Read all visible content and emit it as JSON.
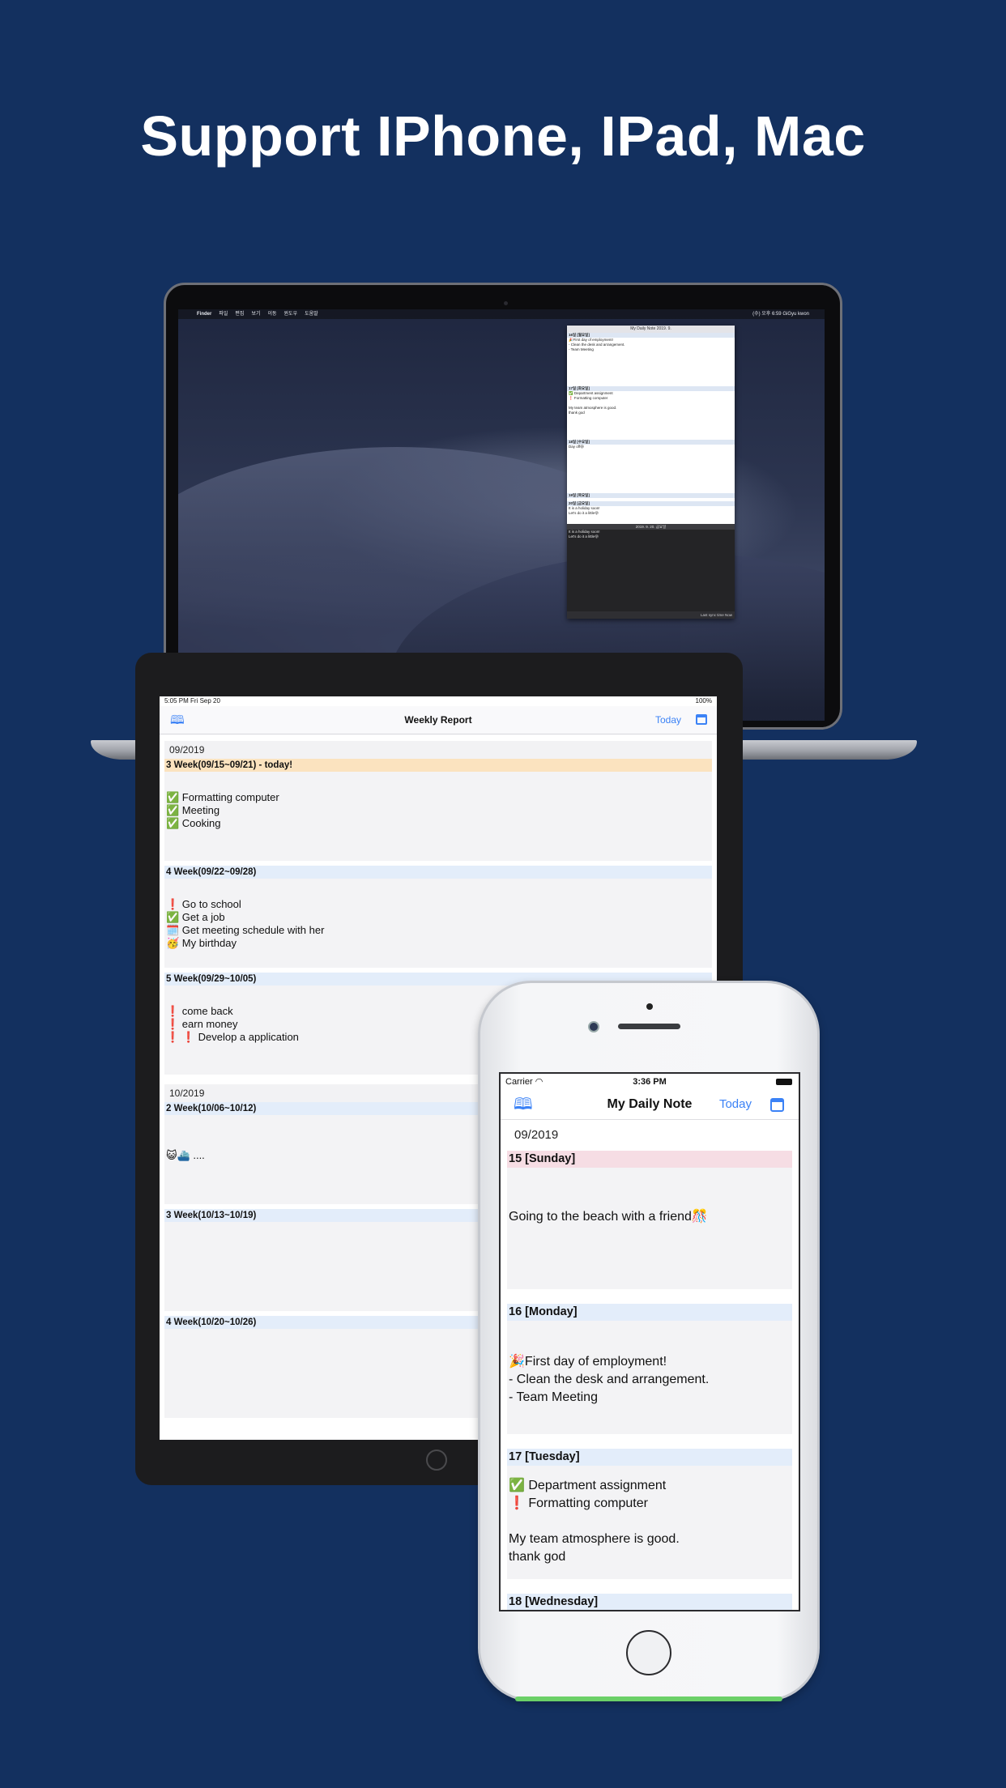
{
  "headline": "Support IPhone, IPad, Mac",
  "colors": {
    "background": "#13305f",
    "accent": "#3b82f6",
    "today_week": "#fbe3bf",
    "week_header": "#e3edfa",
    "sunday_header": "#f6dde4"
  },
  "mac": {
    "menubar_items": [
      "Finder",
      "파일",
      "편집",
      "보기",
      "이동",
      "윈도우",
      "도움말"
    ],
    "menubar_right": "(수) 오후 6:59   GiGyu kwon",
    "window": {
      "title": "My Daily Note   2019.  9.",
      "sections": [
        {
          "header": "16일 [월요일]",
          "lines": [
            "🎉First day of employment!",
            "- Clean the desk and arrangement.",
            "- Team Meeting"
          ]
        },
        {
          "header": "17일 [화요일]",
          "lines": [
            "✅ Department assignment",
            "❗ Formatting computer",
            "",
            "My team atmosphere is good.",
            "thank god"
          ]
        },
        {
          "header": "18일 [수요일]",
          "lines": [
            "Day off😆"
          ]
        },
        {
          "header": "19일 [목요일]",
          "lines": []
        },
        {
          "header": "20일 [금요일]",
          "lines": [
            "It is a holiday soon!",
            "Let's do it a little😝"
          ]
        }
      ],
      "editor_title": "2019. 9. 20. 금요일",
      "editor_lines": [
        "It is a holiday soon!",
        "Let's do it a little😝"
      ],
      "footer": "Last sync time  Now"
    }
  },
  "ipad": {
    "status_left": "5:05 PM   Fri Sep 20",
    "status_right": "100%",
    "nav_title": "Weekly Report",
    "today_label": "Today",
    "months": [
      {
        "label": "09/2019",
        "weeks": [
          {
            "header": "3 Week(09/15~09/21) - today!",
            "today": true,
            "lines": [
              "✅ Formatting computer",
              "✅ Meeting",
              "✅ Cooking"
            ]
          },
          {
            "header": "4 Week(09/22~09/28)",
            "today": false,
            "lines": [
              "❗ Go to school",
              "✅ Get a job",
              "🗓️ Get meeting schedule with her",
              "🥳 My birthday"
            ]
          },
          {
            "header": "5 Week(09/29~10/05)",
            "today": false,
            "lines": [
              "❗ come back",
              "❗ earn money",
              "❗ ❗ Develop a application"
            ]
          }
        ]
      },
      {
        "label": "10/2019",
        "weeks": [
          {
            "header": "2 Week(10/06~10/12)",
            "today": false,
            "lines": [
              "😺⛴️ ...."
            ]
          },
          {
            "header": "3 Week(10/13~10/19)",
            "today": false,
            "lines": []
          },
          {
            "header": "4 Week(10/20~10/26)",
            "today": false,
            "lines": []
          }
        ]
      }
    ]
  },
  "iphone": {
    "carrier": "Carrier",
    "time": "3:36 PM",
    "nav_title": "My Daily Note",
    "today_label": "Today",
    "month": "09/2019",
    "days": [
      {
        "header": "15 [Sunday]",
        "sunday": true,
        "lines": [
          "Going to the beach with a friend🎊"
        ]
      },
      {
        "header": "16 [Monday]",
        "sunday": false,
        "lines": [
          "🎉First day of employment!",
          "- Clean the desk and arrangement.",
          "- Team Meeting"
        ]
      },
      {
        "header": "17 [Tuesday]",
        "sunday": false,
        "lines": [
          "✅ Department assignment",
          "❗ Formatting computer",
          "",
          " My team atmosphere is good.",
          "thank god"
        ]
      },
      {
        "header": "18 [Wednesday]",
        "sunday": false,
        "lines": []
      }
    ]
  }
}
